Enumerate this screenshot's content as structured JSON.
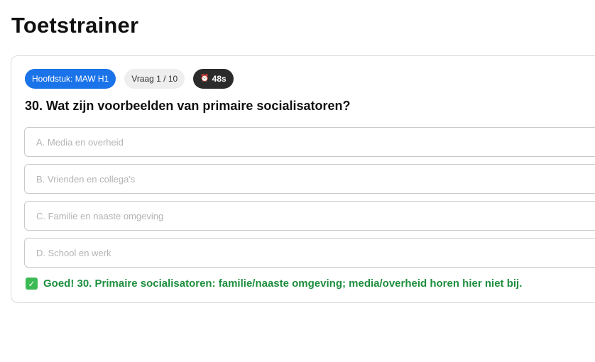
{
  "page": {
    "title": "Toetstrainer"
  },
  "badges": {
    "chapter": "Hoofdstuk: MAW H1",
    "question_counter": "Vraag 1 / 10",
    "timer_icon": "⏰",
    "timer": "48s"
  },
  "question": {
    "text": "30. Wat zijn voorbeelden van primaire socialisatoren?"
  },
  "options": [
    {
      "label": "A. Media en overheid"
    },
    {
      "label": "B. Vrienden en collega's"
    },
    {
      "label": "C. Familie en naaste omgeving"
    },
    {
      "label": "D. School en werk"
    }
  ],
  "feedback": {
    "icon": "check-mark-icon",
    "icon_glyph": "✓",
    "text": "Goed! 30. Primaire socialisatoren: familie/naaste omgeving; media/overheid horen hier niet bij.",
    "color": "#1e8e3e"
  },
  "colors": {
    "chapter_badge": "#1a73e8",
    "timer_badge": "#2b2b2b",
    "success": "#1e8e3e"
  }
}
